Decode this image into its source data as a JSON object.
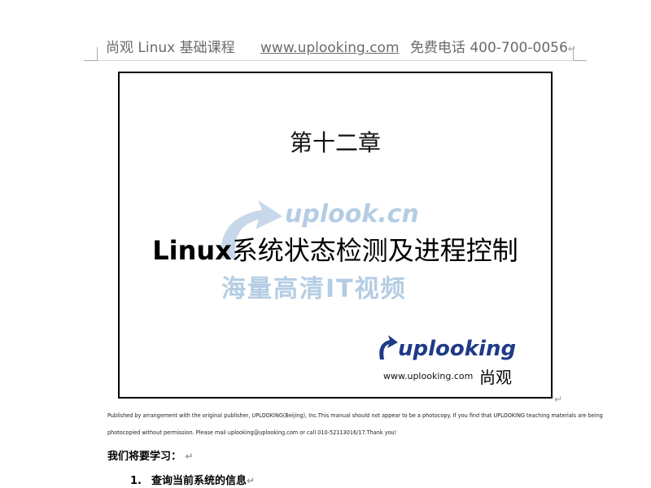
{
  "header": {
    "course": "尚观 Linux 基础课程",
    "website": "www.uplooking.com",
    "hotline": "免费电话 400-700-0056",
    "paragraph_mark": "↵"
  },
  "cover": {
    "chapter": "第十二章",
    "title_latin": "Linux",
    "title_cn": "系统状态检测及进程控制",
    "watermark": {
      "domain": "uplook.cn",
      "tagline": "海量高清IT视频"
    },
    "brand": {
      "logo_text": "uplooking",
      "url": "www.uplooking.com",
      "cn_name": "尚观"
    }
  },
  "notice": {
    "line1": "Published by arrangement with the original publisher, UPLOOKING(Beijing), Inc.This manual should not appear to be a photocopy. If you find that UPLOOKING teaching materials are being",
    "line2": "photocopied without permission. Please mail uplooking@uplooking.com or call 010-52113016/17.Thank you!"
  },
  "section": {
    "heading": "我们将要学习：",
    "items": [
      {
        "number": "1.",
        "text": "查询当前系统的信息"
      }
    ]
  },
  "colors": {
    "watermark": "#b4cde4",
    "brand": "#1f3a87",
    "header_text": "#6b6b6b"
  }
}
